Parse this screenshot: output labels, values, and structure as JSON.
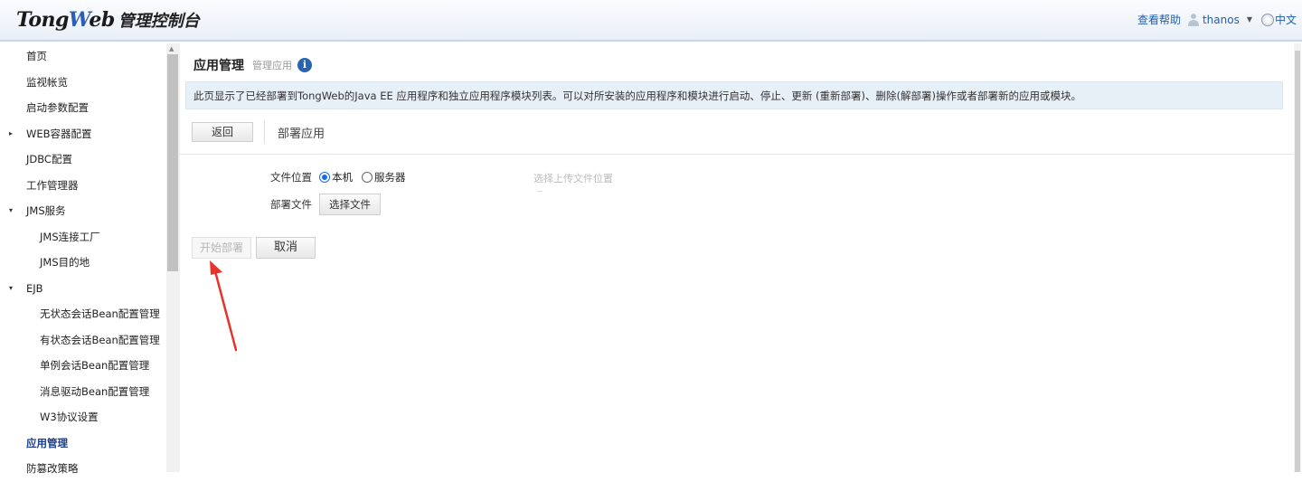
{
  "header": {
    "logo_brand_a": "Tong",
    "logo_brand_w": "W",
    "logo_brand_b": "eb",
    "logo_subtitle": "管理控制台",
    "help_link": "查看帮助",
    "username": "thanos",
    "language": "中文"
  },
  "sidebar": {
    "items": [
      {
        "label": "首页"
      },
      {
        "label": "监视帐览"
      },
      {
        "label": "启动参数配置"
      },
      {
        "label": "WEB容器配置",
        "arrow": "▸"
      },
      {
        "label": "JDBC配置"
      },
      {
        "label": "工作管理器"
      },
      {
        "label": "JMS服务",
        "arrow": "▾"
      },
      {
        "label": "JMS连接工厂"
      },
      {
        "label": "JMS目的地"
      },
      {
        "label": "EJB",
        "arrow": "▾"
      },
      {
        "label": "无状态会话Bean配置管理"
      },
      {
        "label": "有状态会话Bean配置管理"
      },
      {
        "label": "单例会话Bean配置管理"
      },
      {
        "label": "消息驱动Bean配置管理"
      },
      {
        "label": "W3协议设置"
      },
      {
        "label": "应用管理"
      },
      {
        "label": "防篡改策略"
      }
    ]
  },
  "main": {
    "title": "应用管理",
    "subtitle": "管理应用",
    "info_glyph": "i",
    "description": "此页显示了已经部署到TongWeb的Java EE 应用程序和独立应用程序模块列表。可以对所安装的应用程序和模块进行启动、停止、更新 (重新部署)、删除(解部署)操作或者部署新的应用或模块。",
    "back_button": "返回",
    "section_title": "部署应用",
    "form": {
      "file_location_label": "文件位置",
      "option_local": "本机",
      "option_server": "服务器",
      "upload_hint": "选择上传文件位置",
      "deploy_file_label": "部署文件",
      "choose_file_button": "选择文件"
    },
    "start_deploy_button": "开始部署",
    "cancel_button": "取消"
  },
  "colors": {
    "annotation_arrow": "#e8332a",
    "accent": "#2a64b0"
  }
}
